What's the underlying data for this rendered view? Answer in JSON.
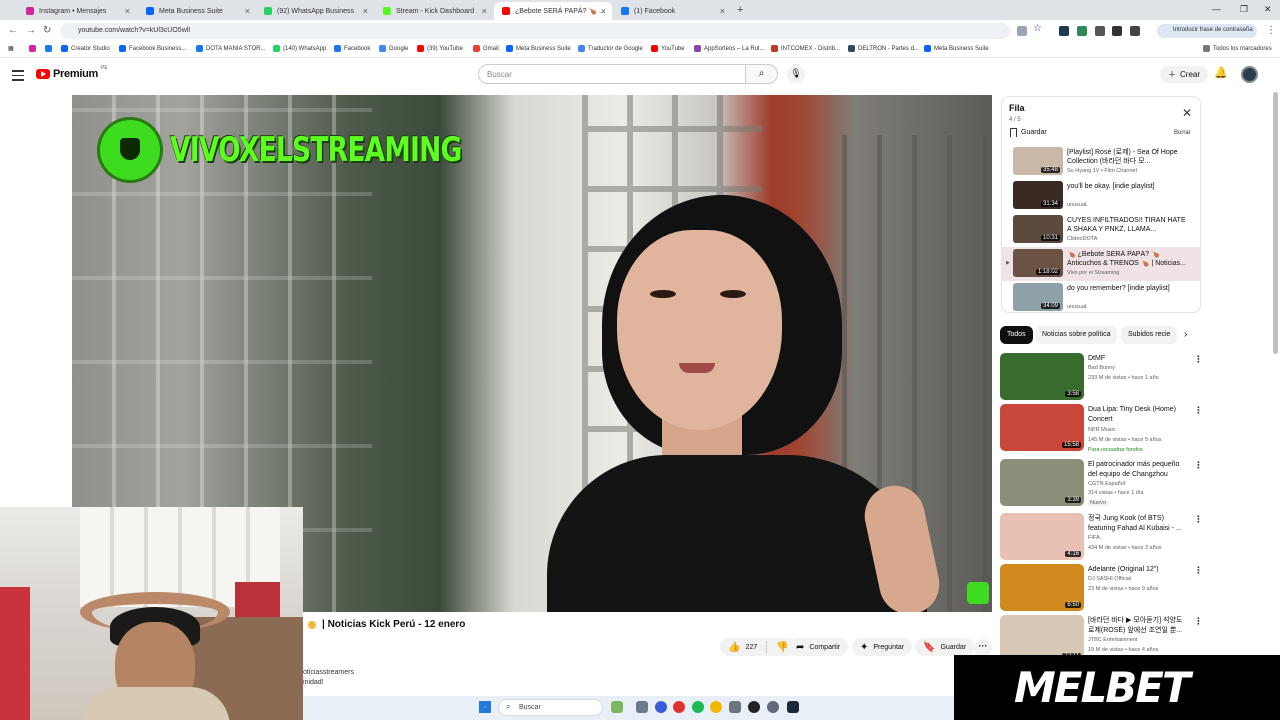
{
  "browser": {
    "tabs": [
      {
        "label": "Instagram • Mensajes",
        "color": "#d6249f"
      },
      {
        "label": "Meta Business Suite",
        "color": "#0866ff"
      },
      {
        "label": "(92) WhatsApp Business",
        "color": "#25d366"
      },
      {
        "label": "Stream - Kick Dashboard",
        "color": "#53fc18"
      },
      {
        "label": "¿Bebote SERÁ PAPÁ? 🍗 ...",
        "color": "#ff0000"
      },
      {
        "label": "(1) Facebook",
        "color": "#1877f2"
      }
    ],
    "new_tab": "+",
    "url": "youtube.com/watch?v=kUl3cUO5wlI",
    "password_button": "Introducir frase de contraseña",
    "bookmarks": [
      {
        "label": "Creator Studio",
        "color": "#0866ff"
      },
      {
        "label": "Facebook Business...",
        "color": "#0866ff"
      },
      {
        "label": "DOTA MANIA STOR...",
        "color": "#1877f2"
      },
      {
        "label": "(140) WhatsApp",
        "color": "#25d366"
      },
      {
        "label": "Facebook",
        "color": "#1877f2"
      },
      {
        "label": "Google",
        "color": "#4285f4"
      },
      {
        "label": "(39) YouTube",
        "color": "#ff0000"
      },
      {
        "label": "Gmail",
        "color": "#ea4335"
      },
      {
        "label": "Meta Business Suite",
        "color": "#0866ff"
      },
      {
        "label": "Traductor de Google",
        "color": "#4285f4"
      },
      {
        "label": "YouTube",
        "color": "#ff0000"
      },
      {
        "label": "AppSorteos – La Rul...",
        "color": "#8e44ad"
      },
      {
        "label": "INTCOMEX - Distrib...",
        "color": "#c0392b"
      },
      {
        "label": "DELTRON - Partes d...",
        "color": "#34495e"
      },
      {
        "label": "Meta Business Suite",
        "color": "#0866ff"
      }
    ],
    "all_bookmarks": "Todos los marcadores"
  },
  "youtube": {
    "logo_text": "Premium",
    "logo_region": "PE",
    "search_placeholder": "Buscar",
    "create_label": "Crear",
    "video": {
      "watermark": "VIVOXELSTREAMING",
      "title": "| Noticias Kick Perú - 12 enero",
      "likes": "227",
      "share": "Compartir",
      "ask": "Preguntar",
      "save": "Guardar",
      "channel_lines": [
        "oticiasstreamers",
        "inidad!"
      ]
    },
    "queue": {
      "title": "Fila",
      "count": "4 / 5",
      "save": "Guardar",
      "clear": "Borrar",
      "items": [
        {
          "title": "[Playlist] Rosé (로제) - Sea Of Hope Collection (바라던 바다 모...",
          "channel": "So Hyang 1V • Film Channel",
          "duration": "35:48",
          "thumb": "#c9b8a8",
          "active": false
        },
        {
          "title": "you'll be okay. [indie playlist]",
          "channel": "unusual.",
          "duration": "31:34",
          "thumb": "#3a2a24",
          "active": false
        },
        {
          "title": "CUYES INFILTRADOS!! TIRAN HATE A SHAKA Y PNKZ, LLAMA...",
          "channel": "ClideoDOTA",
          "duration": "10:31",
          "thumb": "#5c4a3e",
          "active": false
        },
        {
          "title": "🍗 ¿Bebote SERÁ PAPÁ? 🍗 Anticuchos & TRENOS 🍗 | Noticias...",
          "channel": "Vivo por el Streaming",
          "duration": "1:18:02",
          "thumb": "#6a5244",
          "active": true
        },
        {
          "title": "do you remember? [indie playlist]",
          "channel": "unusual.",
          "duration": "34:09",
          "thumb": "#8ea0a8",
          "active": false
        }
      ]
    },
    "chips": [
      "Todos",
      "Noticias sobre política",
      "Subidos recie"
    ],
    "recommendations": [
      {
        "title": "DtMF",
        "channel": "Bad Bunny",
        "meta": "233 M de vistas • hace 1 año",
        "tag": "",
        "duration": "3:58",
        "thumb": "#3a6b2e"
      },
      {
        "title": "Dua Lipa: Tiny Desk (Home) Concert",
        "channel": "NPR Music",
        "meta": "145 M de vistas • hace 5 años",
        "tag": "Para recuadrar fondos",
        "duration": "15:58",
        "thumb": "#c9473a"
      },
      {
        "title": "El patrocinador más pequeño del equipo de Changzhou",
        "channel": "CGTN Español",
        "meta": "314 vistas • hace 1 día",
        "tag": "Nuevo",
        "duration": "3:39",
        "thumb": "#8a8f7a"
      },
      {
        "title": "정국 Jung Kook (of BTS) featuring Fahad Al Kubaisi - ...",
        "channel": "FIFA",
        "meta": "434 M de vistas • hace 3 años",
        "tag": "",
        "duration": "4:16",
        "thumb": "#e9c1b4"
      },
      {
        "title": "Adelante (Original 12\")",
        "channel": "DJ SASHI Official",
        "meta": "23 M de vistas • hace 9 años",
        "tag": "",
        "duration": "6:50",
        "thumb": "#d08a1e"
      },
      {
        "title": "[바라던 바다 ▶ 모아듣기] 석양도 로제(ROSÉ) 앞에선 조연일 뿐...",
        "channel": "JTBC Entertainment",
        "meta": "19 M de vistas • hace 4 años",
        "tag": "",
        "duration": "22:11",
        "thumb": "#d7c8b5"
      }
    ]
  },
  "taskbar": {
    "search": "Buscar"
  },
  "ad": {
    "brand": "MELBET"
  }
}
